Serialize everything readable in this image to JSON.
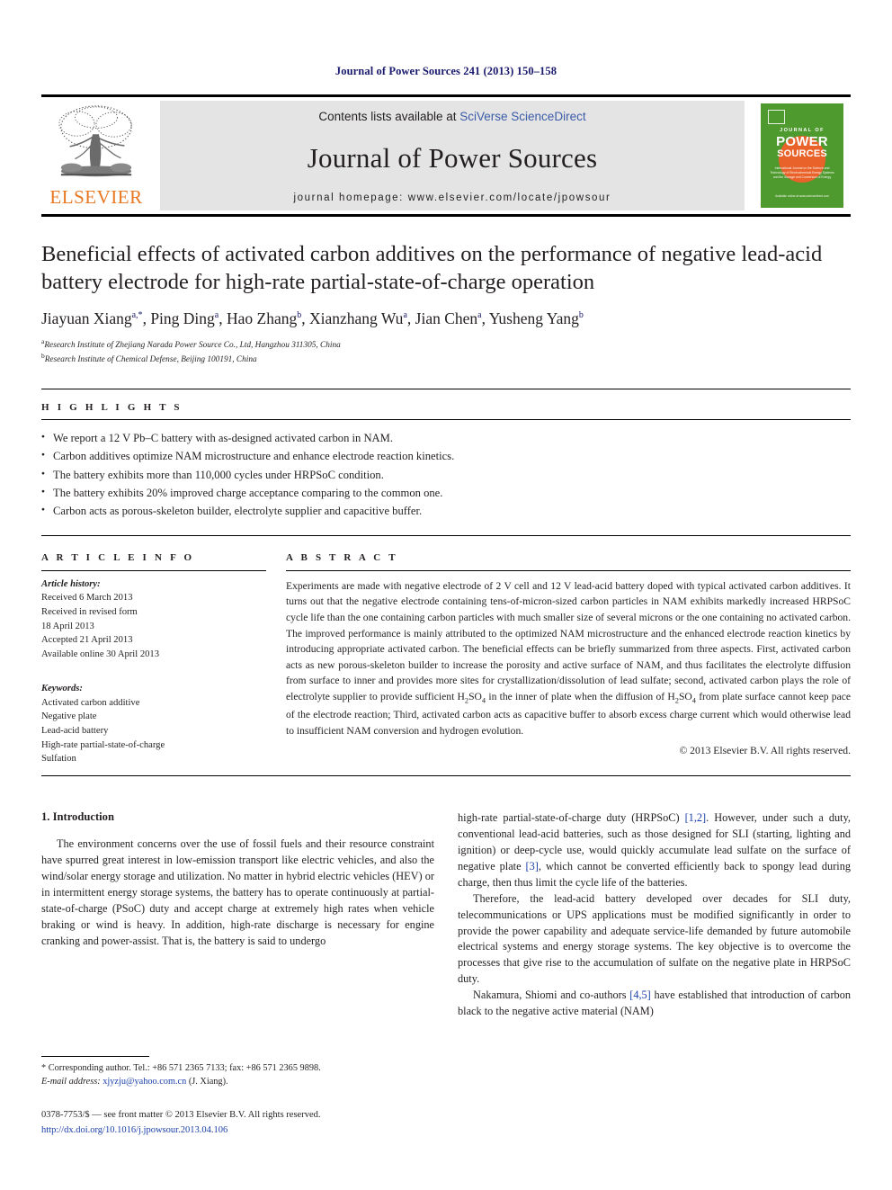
{
  "running_head": "Journal of Power Sources 241 (2013) 150–158",
  "masthead": {
    "contents_prefix": "Contents lists available at ",
    "contents_link": "SciVerse ScienceDirect",
    "journal_title": "Journal of Power Sources",
    "homepage": "journal homepage: www.elsevier.com/locate/jpowsour",
    "publisher_wordmark": "ELSEVIER",
    "cover": {
      "journal_of": "JOURNAL OF",
      "power": "POWER",
      "sources": "SOURCES",
      "subtitle": "International Journal on the Science and Technology of Electrochemical Energy Systems and the Storage and Conversion of Energy",
      "footer": "Available online at www.sciencedirect.com"
    },
    "accent_orange": "#E87722",
    "cover_green": "#4f9a2f",
    "link_blue": "#3b5ca8"
  },
  "article": {
    "title": "Beneficial effects of activated carbon additives on the performance of negative lead-acid battery electrode for high-rate partial-state-of-charge operation",
    "authors": [
      {
        "name": "Jiayuan Xiang",
        "marks": "a,*"
      },
      {
        "name": "Ping Ding",
        "marks": "a"
      },
      {
        "name": "Hao Zhang",
        "marks": "b"
      },
      {
        "name": "Xianzhang Wu",
        "marks": "a"
      },
      {
        "name": "Jian Chen",
        "marks": "a"
      },
      {
        "name": "Yusheng Yang",
        "marks": "b"
      }
    ],
    "affiliations": [
      {
        "mark": "a",
        "text": "Research Institute of Zhejiang Narada Power Source Co., Ltd, Hangzhou 311305, China"
      },
      {
        "mark": "b",
        "text": "Research Institute of Chemical Defense, Beijing 100191, China"
      }
    ]
  },
  "highlights": {
    "heading": "H I G H L I G H T S",
    "items": [
      "We report a 12 V Pb–C battery with as-designed activated carbon in NAM.",
      "Carbon additives optimize NAM microstructure and enhance electrode reaction kinetics.",
      "The battery exhibits more than 110,000 cycles under HRPSoC condition.",
      "The battery exhibits 20% improved charge acceptance comparing to the common one.",
      "Carbon acts as porous-skeleton builder, electrolyte supplier and capacitive buffer."
    ]
  },
  "article_info": {
    "heading": "A R T I C L E   I N F O",
    "history_label": "Article history:",
    "history": [
      "Received 6 March 2013",
      "Received in revised form",
      "18 April 2013",
      "Accepted 21 April 2013",
      "Available online 30 April 2013"
    ],
    "keywords_label": "Keywords:",
    "keywords": [
      "Activated carbon additive",
      "Negative plate",
      "Lead-acid battery",
      "High-rate partial-state-of-charge",
      "Sulfation"
    ]
  },
  "abstract": {
    "heading": "A B S T R A C T",
    "part1": "Experiments are made with negative electrode of 2 V cell and 12 V lead-acid battery doped with typical activated carbon additives. It turns out that the negative electrode containing tens-of-micron-sized carbon particles in NAM exhibits markedly increased HRPSoC cycle life than the one containing carbon particles with much smaller size of several microns or the one containing no activated carbon. The improved performance is mainly attributed to the optimized NAM microstructure and the enhanced electrode reaction kinetics by introducing appropriate activated carbon. The beneficial effects can be briefly summarized from three aspects. First, activated carbon acts as new porous-skeleton builder to increase the porosity and active surface of NAM, and thus facilitates the electrolyte diffusion from surface to inner and provides more sites for crystallization/dissolution of lead sulfate; second, activated carbon plays the role of electrolyte supplier to provide sufficient H",
    "sub1": "2",
    "mid1": "SO",
    "sub2": "4",
    "part2": " in the inner of plate when the diffusion of H",
    "sub3": "2",
    "mid2": "SO",
    "sub4": "4",
    "part3": " from plate surface cannot keep pace of the electrode reaction; Third, activated carbon acts as capacitive buffer to absorb excess charge current which would otherwise lead to insufficient NAM conversion and hydrogen evolution.",
    "copyright": "© 2013 Elsevier B.V. All rights reserved."
  },
  "body": {
    "section_number_title": "1.  Introduction",
    "left_para1": "The environment concerns over the use of fossil fuels and their resource constraint have spurred great interest in low-emission transport like electric vehicles, and also the wind/solar energy storage and utilization. No matter in hybrid electric vehicles (HEV) or in intermittent energy storage systems, the battery has to operate continuously at partial-state-of-charge (PSoC) duty and accept charge at extremely high rates when vehicle braking or wind is heavy. In addition, high-rate discharge is necessary for engine cranking and power-assist. That is, the battery is said to undergo",
    "right_para1_a": "high-rate partial-state-of-charge duty (HRPSoC) ",
    "right_ref_12": "[1,2]",
    "right_para1_b": ". However, under such a duty, conventional lead-acid batteries, such as those designed for SLI (starting, lighting and ignition) or deep-cycle use, would quickly accumulate lead sulfate on the surface of negative plate ",
    "right_ref_3": "[3]",
    "right_para1_c": ", which cannot be converted efficiently back to spongy lead during charge, then thus limit the cycle life of the batteries.",
    "right_para2": "Therefore, the lead-acid battery developed over decades for SLI duty, telecommunications or UPS applications must be modified significantly in order to provide the power capability and adequate service-life demanded by future automobile electrical systems and energy storage systems. The key objective is to overcome the processes that give rise to the accumulation of sulfate on the negative plate in HRPSoC duty.",
    "right_para3_a": "Nakamura, Shiomi and co-authors ",
    "right_ref_45": "[4,5]",
    "right_para3_b": " have established that introduction of carbon black to the negative active material (NAM)"
  },
  "footnote": {
    "corresponding": "* Corresponding author. Tel.: +86 571 2365 7133; fax: +86 571 2365 9898.",
    "email_label": "E-mail address:",
    "email": "xjyzju@yahoo.com.cn",
    "email_owner": "(J. Xiang).",
    "issn_line": "0378-7753/$ — see front matter © 2013 Elsevier B.V. All rights reserved.",
    "doi": "http://dx.doi.org/10.1016/j.jpowsour.2013.04.106"
  }
}
